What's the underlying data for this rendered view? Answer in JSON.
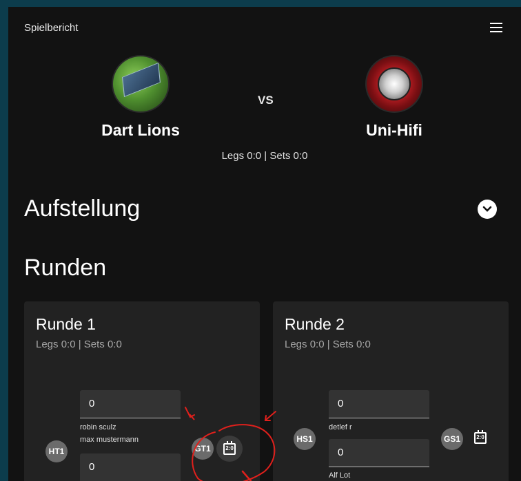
{
  "app": {
    "title": "Spielbericht"
  },
  "icons": {
    "menu": "menu-icon",
    "expand": "chevron-down-icon",
    "board": "scoreboard-icon"
  },
  "match": {
    "home": {
      "name": "Dart Lions"
    },
    "away": {
      "name": "Uni-Hifi"
    },
    "vs": "VS",
    "score": "Legs 0:0 | Sets 0:0"
  },
  "sections": {
    "lineup": "Aufstellung",
    "rounds": "Runden"
  },
  "rounds": [
    {
      "title": "Runde 1",
      "score": "Legs 0:0 | Sets 0:0",
      "home_badge": "HT1",
      "away_badge": "GT1",
      "field1": "0",
      "player1": "robin sculz",
      "player2": "max mustermann",
      "field2": "0",
      "board_label": "2:0"
    },
    {
      "title": "Runde 2",
      "score": "Legs 0:0 | Sets 0:0",
      "home_badge": "HS1",
      "away_badge": "GS1",
      "field1": "0",
      "player1": "detlef r",
      "field2": "0",
      "player2": "Alf Lot",
      "board_label": "2:0"
    }
  ],
  "colors": {
    "background": "#121212",
    "card": "#222222",
    "annotation": "#e0201c"
  }
}
